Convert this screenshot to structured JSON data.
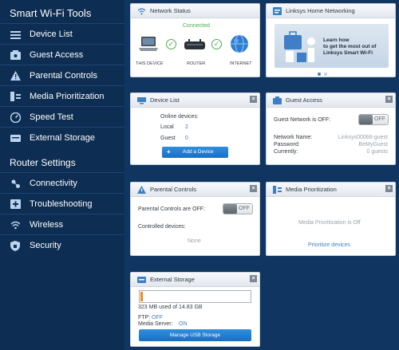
{
  "sidebar": {
    "tools_title": "Smart Wi-Fi Tools",
    "tools": [
      {
        "label": "Device List",
        "icon": "device-list-icon"
      },
      {
        "label": "Guest Access",
        "icon": "guest-access-icon"
      },
      {
        "label": "Parental Controls",
        "icon": "parental-controls-icon"
      },
      {
        "label": "Media Prioritization",
        "icon": "media-prioritization-icon"
      },
      {
        "label": "Speed Test",
        "icon": "speed-test-icon"
      },
      {
        "label": "External Storage",
        "icon": "external-storage-icon"
      }
    ],
    "router_title": "Router Settings",
    "router": [
      {
        "label": "Connectivity",
        "icon": "connectivity-icon"
      },
      {
        "label": "Troubleshooting",
        "icon": "troubleshooting-icon"
      },
      {
        "label": "Wireless",
        "icon": "wireless-icon"
      },
      {
        "label": "Security",
        "icon": "security-icon"
      }
    ]
  },
  "network_status": {
    "title": "Network Status",
    "connection": "Connected",
    "this_device": "THIS DEVICE",
    "router": "ROUTER",
    "internet": "INTERNET"
  },
  "home_networking": {
    "title": "Linksys Home Networking",
    "promo_line1": "Learn how",
    "promo_line2": "to get the most out of",
    "promo_line3": "Linksys Smart Wi-Fi"
  },
  "device_list": {
    "title": "Device List",
    "online_label": "Online devices:",
    "local_label": "Local",
    "local_count": "2",
    "guest_label": "Guest",
    "guest_count": "0",
    "add_button": "Add a Device"
  },
  "guest_access": {
    "title": "Guest Access",
    "status_label": "Guest Network is OFF:",
    "toggle": "OFF",
    "name_label": "Network Name:",
    "name_value": "Linksys00066-guest",
    "password_label": "Password:",
    "password_value": "BeMyGuest",
    "currently_label": "Currently:",
    "currently_value": "0 guests"
  },
  "parental_controls": {
    "title": "Parental Controls",
    "status_label": "Parental Controls are OFF:",
    "toggle": "OFF",
    "controlled_label": "Controlled devices:",
    "controlled_value": "None"
  },
  "media_prioritization": {
    "title": "Media Prioritization",
    "status": "Media Prioritization is Off",
    "link": "Prioritize devices"
  },
  "external_storage": {
    "title": "External Storage",
    "usage": "323 MB used of 14.83 GB",
    "usage_fraction": 0.021,
    "ftp_label": "FTP:",
    "ftp_value": "OFF",
    "media_label": "Media Server:",
    "media_value": "ON",
    "manage_button": "Manage USB Storage"
  },
  "colors": {
    "sidebar_bg": "#0d2d52",
    "main_bg": "#0f3560",
    "accent_blue": "#1a6fc0",
    "connected_green": "#4caf50",
    "link_blue": "#3d7fc4"
  }
}
